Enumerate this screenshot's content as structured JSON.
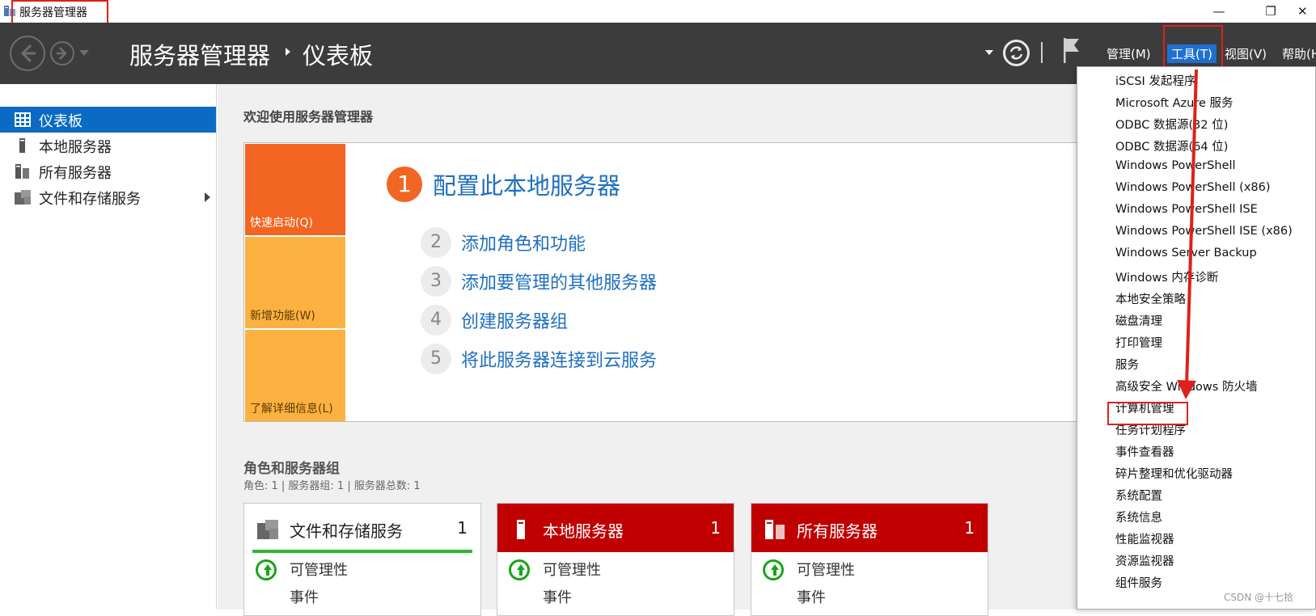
{
  "window": {
    "title": "服务器管理器",
    "minimize": "—",
    "restore": "❐",
    "close": "✕"
  },
  "header": {
    "breadcrumb_root": "服务器管理器",
    "breadcrumb_current": "仪表板",
    "menus": [
      "管理(M)",
      "工具(T)",
      "视图(V)",
      "帮助(H)"
    ]
  },
  "sidebar": {
    "items": [
      {
        "label": "仪表板",
        "icon": "dashboard-icon",
        "active": true
      },
      {
        "label": "本地服务器",
        "icon": "server-icon"
      },
      {
        "label": "所有服务器",
        "icon": "servers-icon"
      },
      {
        "label": "文件和存储服务",
        "icon": "file-storage-icon"
      }
    ]
  },
  "welcome": {
    "title": "欢迎使用服务器管理器",
    "tiles": [
      "快速启动(Q)",
      "新增功能(W)",
      "了解详细信息(L)"
    ],
    "step1_num": "1",
    "step1_label": "配置此本地服务器",
    "steps": [
      {
        "num": "2",
        "label": "添加角色和功能"
      },
      {
        "num": "3",
        "label": "添加要管理的其他服务器"
      },
      {
        "num": "4",
        "label": "创建服务器组"
      },
      {
        "num": "5",
        "label": "将此服务器连接到云服务"
      }
    ]
  },
  "roles": {
    "title": "角色和服务器组",
    "summary": "角色: 1 | 服务器组: 1 | 服务器总数: 1",
    "cards": [
      {
        "title": "文件和存储服务",
        "count": "1",
        "row1": "可管理性",
        "row2": "事件"
      },
      {
        "title": "本地服务器",
        "count": "1",
        "row1": "可管理性",
        "row2": "事件"
      },
      {
        "title": "所有服务器",
        "count": "1",
        "row1": "可管理性",
        "row2": "事件"
      }
    ]
  },
  "tools_menu": {
    "items": [
      "iSCSI 发起程序",
      "Microsoft Azure 服务",
      "ODBC 数据源(32 位)",
      "ODBC 数据源(64 位)",
      "Windows PowerShell",
      "Windows PowerShell (x86)",
      "Windows PowerShell ISE",
      "Windows PowerShell ISE (x86)",
      "Windows Server Backup",
      "Windows 内存诊断",
      "本地安全策略",
      "磁盘清理",
      "打印管理",
      "服务",
      "高级安全 Windows 防火墙",
      "计算机管理",
      "任务计划程序",
      "事件查看器",
      "碎片整理和优化驱动器",
      "系统配置",
      "系统信息",
      "性能监视器",
      "资源监视器",
      "组件服务"
    ]
  },
  "watermark": "CSDN @十七拾",
  "colors": {
    "header_bg": "#3c3c3c",
    "accent_blue": "#0a6ac4",
    "quickstart_orange": "#f26522",
    "tile_amber": "#fdb140",
    "card_red": "#c00000",
    "highlight_red": "#e0201a"
  }
}
